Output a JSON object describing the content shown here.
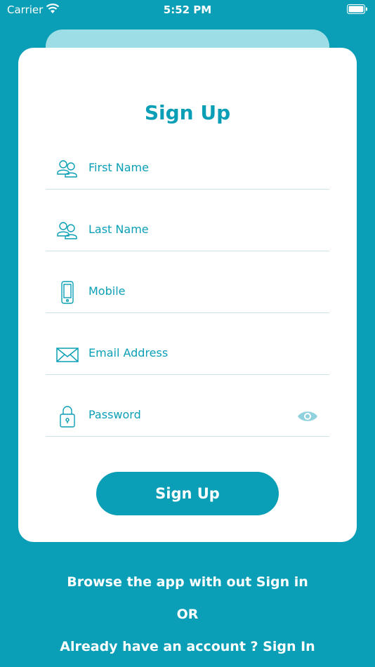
{
  "status_bar": {
    "carrier": "Carrier",
    "time": "5:52 PM"
  },
  "form": {
    "title": "Sign Up",
    "fields": [
      {
        "label": "First Name",
        "icon": "users-icon"
      },
      {
        "label": "Last Name",
        "icon": "users-icon"
      },
      {
        "label": "Mobile",
        "icon": "mobile-phone-icon"
      },
      {
        "label": "Email Address",
        "icon": "envelope-icon"
      },
      {
        "label": "Password",
        "icon": "lock-icon"
      }
    ],
    "submit_label": "Sign Up"
  },
  "footer": {
    "browse_label": "Browse the app with out Sign in",
    "or_label": "OR",
    "account_prompt": "Already have an account ? ",
    "signin_label": "Sign In"
  },
  "colors": {
    "accent": "#0a9fb6",
    "card_back": "#9ddde6",
    "divider": "#cfe4ea",
    "eye": "#8fd1dc"
  }
}
